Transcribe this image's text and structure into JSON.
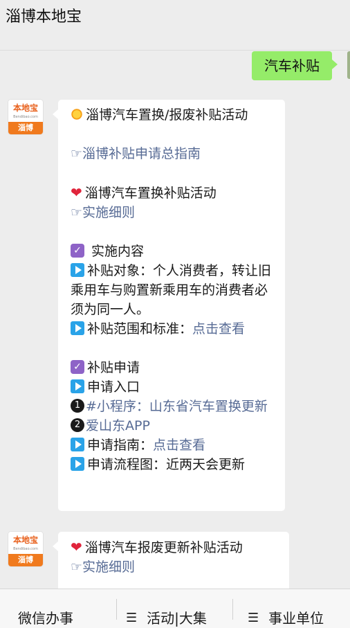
{
  "header": {
    "title": "淄博本地宝"
  },
  "outgoing": {
    "text": "汽车补贴"
  },
  "avatar": {
    "brand": "本地宝",
    "site": "Bendibao.com",
    "city": "淄博"
  },
  "message1": {
    "sections": {
      "heading1": "淄博汽车置换/报废补贴活动",
      "guide_hand": "☞",
      "guide_link": "淄博补贴申请总指南",
      "heading2": "淄博汽车置换补贴活动",
      "rules_hand": "☞",
      "rules_link": "实施细则",
      "content_title": "实施内容",
      "target_line": "补贴对象：个人消费者，转让旧乘用车与购置新乘用车的消费者必须为同一人。",
      "scope_label": "补贴范围和标准：",
      "scope_link": "点击查看",
      "apply_title": "补贴申请",
      "entry_title": "申请入口",
      "entry1_num": "❶",
      "entry1_link": "#小程序：山东省汽车置换更新",
      "entry2_num": "❷",
      "entry2_link": "爱山东APP",
      "guide2_label": "申请指南：",
      "guide2_link": "点击查看",
      "flow_label": "申请流程图：近两天会更新"
    }
  },
  "message2": {
    "heading": "淄博汽车报废更新补贴活动",
    "rules_hand": "☞",
    "rules_link": "实施细则"
  },
  "bottom_nav": {
    "tabs": [
      {
        "label": "微信办事",
        "icon": ""
      },
      {
        "label": "活动|大集",
        "icon": "☰"
      },
      {
        "label": "事业单位",
        "icon": "☰"
      }
    ]
  },
  "colors": {
    "link": "#576b95",
    "outgoing": "#95ec69",
    "accent": "#f07a1e"
  }
}
